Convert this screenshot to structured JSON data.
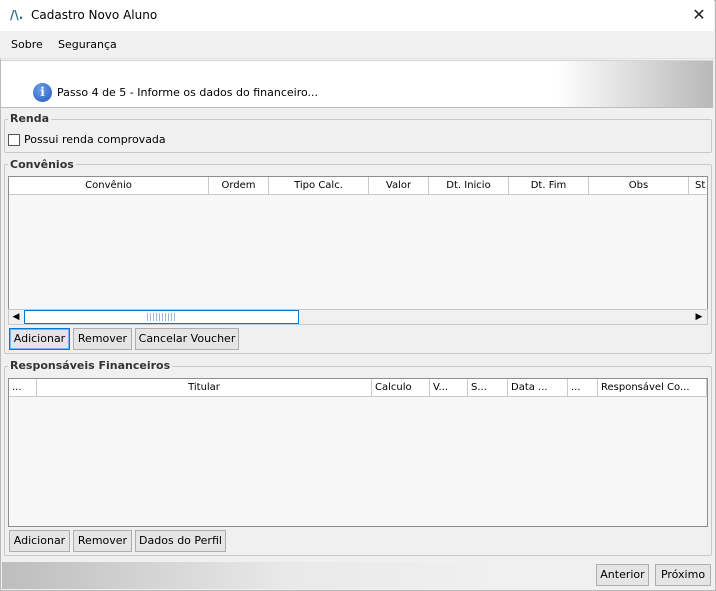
{
  "window": {
    "title": "Cadastro Novo Aluno",
    "close_symbol": "✕"
  },
  "menu": {
    "items": [
      "Sobre",
      "Segurança"
    ]
  },
  "step": {
    "text": "Passo 4 de 5 - Informe os dados do financeiro..."
  },
  "renda": {
    "legend": "Renda",
    "checkbox_label": "Possui renda comprovada",
    "checked": false
  },
  "convenios": {
    "legend": "Convênios",
    "columns": [
      "Convênio",
      "Ordem",
      "Tipo Calc.",
      "Valor",
      "Dt. Inicio",
      "Dt. Fim",
      "Obs",
      "St"
    ],
    "rows": [],
    "scroll_position": 0,
    "buttons": {
      "add": "Adicionar",
      "remove": "Remover",
      "cancel_voucher": "Cancelar Voucher"
    }
  },
  "responsaveis": {
    "legend": "Responsáveis Financeiros",
    "columns": [
      "...",
      "Titular",
      "Calculo",
      "V...",
      "S...",
      "Data ...",
      "...",
      "Responsável Co..."
    ],
    "rows": [],
    "buttons": {
      "add": "Adicionar",
      "remove": "Remover",
      "profile": "Dados do Perfil"
    }
  },
  "nav": {
    "previous": "Anterior",
    "next": "Próximo"
  }
}
